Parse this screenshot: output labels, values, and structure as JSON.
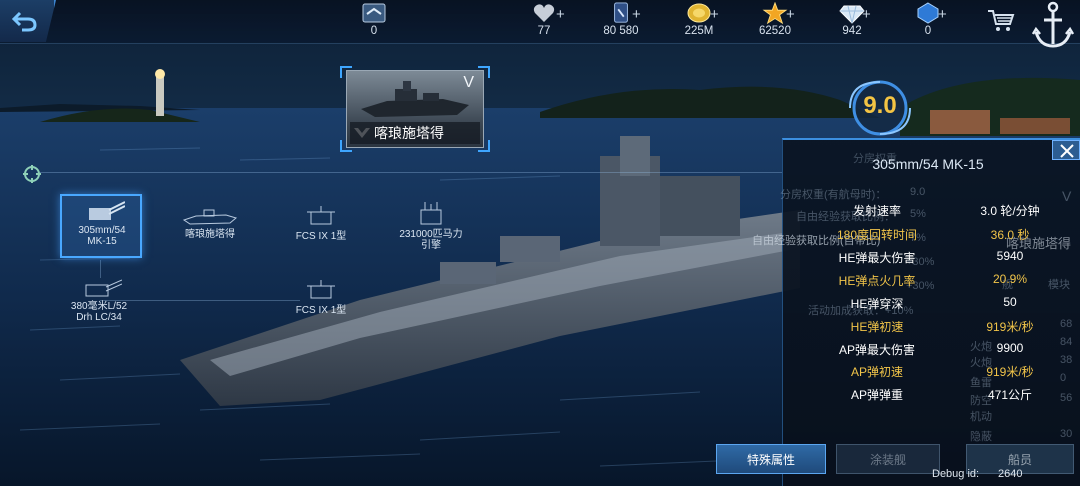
{
  "topbar": {
    "stats": [
      {
        "name": "rank-badge",
        "value": "0"
      },
      {
        "name": "heart",
        "value": "77"
      },
      {
        "name": "card",
        "value": "80 580"
      },
      {
        "name": "coin",
        "value": "225M"
      },
      {
        "name": "star",
        "value": "62520"
      },
      {
        "name": "diamond",
        "value": "942"
      },
      {
        "name": "gem",
        "value": "0"
      }
    ],
    "plus": "+"
  },
  "ship": {
    "name": "喀琅施塔得",
    "tier": "V",
    "score": "9.0"
  },
  "modules": [
    {
      "key": "gun-305",
      "label": "305mm/54\nMK-15",
      "selected": true
    },
    {
      "key": "hull",
      "label": "喀琅施塔得",
      "selected": false
    },
    {
      "key": "fcs-top",
      "label": "FCS IX 1型",
      "selected": false
    },
    {
      "key": "engine",
      "label": "231000匹马力\n引擎",
      "selected": false
    },
    {
      "key": "gun-380",
      "label": "380毫米L/52\nDrh LC/34",
      "selected": false
    },
    {
      "key": "fcs-bottom",
      "label": "FCS IX 1型",
      "selected": false
    }
  ],
  "panel": {
    "ghost_title": "分房权重",
    "title": "305mm/54 MK-15",
    "rows": [
      {
        "label": "发射速率",
        "value": "3.0 轮/分钟",
        "style": "white"
      },
      {
        "label": "180度回转时间",
        "value": "36.0 秒",
        "style": "gold"
      },
      {
        "label": "HE弹最大伤害",
        "value": "5940",
        "style": "white"
      },
      {
        "label": "HE弹点火几率",
        "value": "20.9%",
        "style": "gold"
      },
      {
        "label": "HE弹穿深",
        "value": "50",
        "style": "white"
      },
      {
        "label": "HE弹初速",
        "value": "919米/秒",
        "style": "gold"
      },
      {
        "label": "AP弹最大伤害",
        "value": "9900",
        "style": "white"
      },
      {
        "label": "AP弹初速",
        "value": "919米/秒",
        "style": "gold"
      },
      {
        "label": "AP弹弹重",
        "value": "471公斤",
        "style": "white"
      }
    ],
    "ghost": {
      "weight_label": "分房权重(有航母时)：",
      "weight_value": "9.0",
      "exp1": "自由经验获取比例：",
      "exp1_value": "5%",
      "exp2": "自由经验获取比例(自带比)",
      "exp2_value": "7%",
      "bonus1": "+30%",
      "bonus2": "+30%",
      "bonus3": "活动加成获取：+10%",
      "shipname": "喀琅施塔得",
      "v": "V",
      "btn_module": "模块",
      "btn_main": "舰",
      "side": [
        "火炮",
        "火炮",
        "鱼雷",
        "防空",
        "机动",
        "隐蔽"
      ],
      "nums": [
        "68",
        "84",
        "38",
        "0",
        "56",
        "30"
      ]
    }
  },
  "tabs": {
    "special": "特殊属性",
    "paint": "涂装舰",
    "crew": "船员"
  },
  "debug": {
    "label": "Debug id:",
    "value": "2640"
  }
}
